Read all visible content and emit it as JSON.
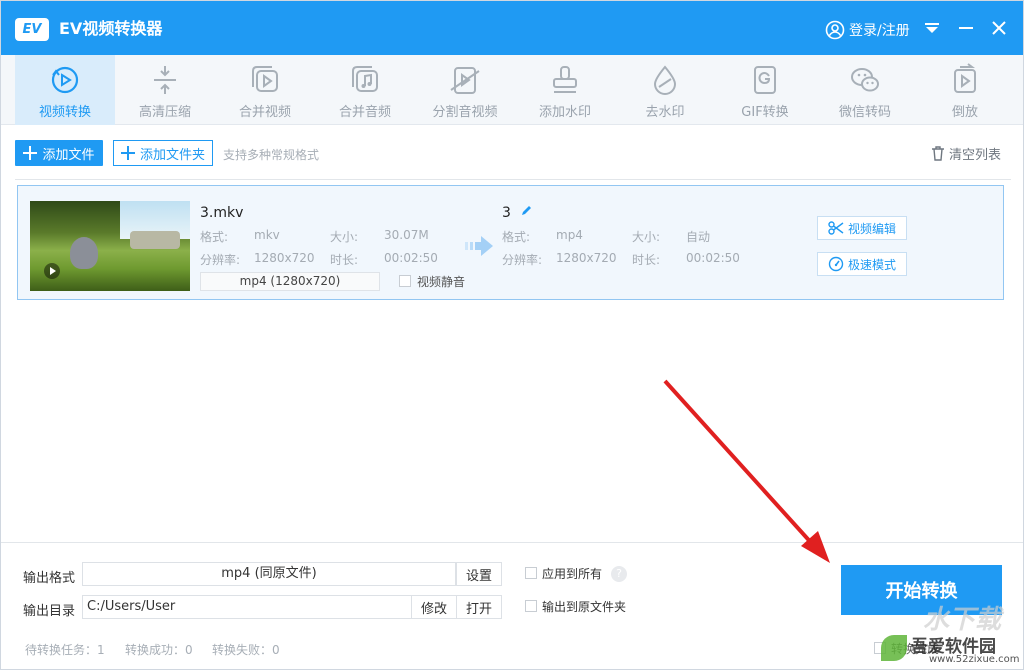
{
  "window": {
    "logo_text": "EV",
    "title": "EV视频转换器",
    "login_label": "登录/注册"
  },
  "toolbar": {
    "items": [
      {
        "label": "视频转换",
        "icon": "convert-icon",
        "active": true
      },
      {
        "label": "高清压缩",
        "icon": "compress-icon"
      },
      {
        "label": "合并视频",
        "icon": "merge-video-icon"
      },
      {
        "label": "合并音频",
        "icon": "merge-audio-icon"
      },
      {
        "label": "分割音视频",
        "icon": "split-icon"
      },
      {
        "label": "添加水印",
        "icon": "stamp-icon"
      },
      {
        "label": "去水印",
        "icon": "drop-icon"
      },
      {
        "label": "GIF转换",
        "icon": "gif-icon"
      },
      {
        "label": "微信转码",
        "icon": "wechat-icon"
      },
      {
        "label": "倒放",
        "icon": "reverse-icon"
      }
    ]
  },
  "actions": {
    "add_file": "添加文件",
    "add_folder": "添加文件夹",
    "hint": "支持多种常规格式",
    "clear": "清空列表"
  },
  "file": {
    "name": "3.mkv",
    "src": {
      "format_label": "格式:",
      "format": "mkv",
      "size_label": "大小:",
      "size": "30.07M",
      "res_label": "分辨率:",
      "res": "1280x720",
      "dur_label": "时长:",
      "dur": "00:02:50"
    },
    "output_select": "mp4 (1280x720)",
    "mute_label": "视频静音",
    "out": {
      "name": "3",
      "format_label": "格式:",
      "format": "mp4",
      "size_label": "大小:",
      "size": "自动",
      "res_label": "分辨率:",
      "res": "1280x720",
      "dur_label": "时长:",
      "dur": "00:02:50"
    },
    "edit_btn": "视频编辑",
    "fast_btn": "极速模式"
  },
  "bottom": {
    "format_label": "输出格式",
    "format_value": "mp4 (同原文件)",
    "settings": "设置",
    "apply_all": "应用到所有",
    "help": "?",
    "dir_label": "输出目录",
    "dir_value": "C:/Users/User",
    "modify": "修改",
    "open": "打开",
    "to_source": "输出到原文件夹",
    "start": "开始转换",
    "pending": "待转换任务：1",
    "success": "转换成功：0",
    "failed": "转换失败：0",
    "after_label": "转换完成"
  },
  "watermark": {
    "cn": "吾爱软件园",
    "en": "www.52zixue.com",
    "big": "水下载"
  },
  "colors": {
    "accent": "#1f9af3",
    "toolbar_bg": "#f4f7fa",
    "arrow": "#e02020"
  }
}
